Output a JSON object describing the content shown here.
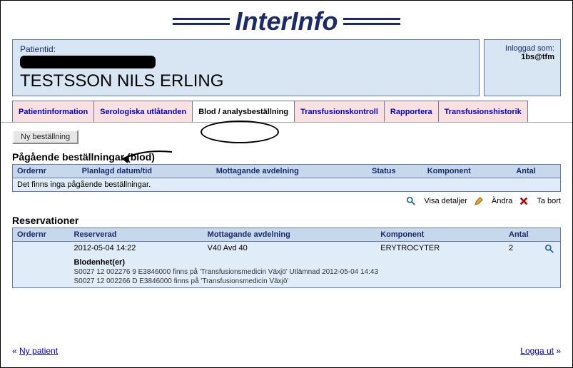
{
  "app_name": "InterInfo",
  "login": {
    "label": "Inloggad som:",
    "user": "1bs@tfm"
  },
  "patient": {
    "label": "Patientid:",
    "name": "TESTSSON NILS ERLING"
  },
  "tabs": [
    {
      "label": "Patientinformation"
    },
    {
      "label": "Serologiska utlåtanden"
    },
    {
      "label": "Blod / analysbeställning"
    },
    {
      "label": "Transfusionskontroll"
    },
    {
      "label": "Rapportera"
    },
    {
      "label": "Transfusionshistorik"
    }
  ],
  "buttons": {
    "new_order": "Ny beställning"
  },
  "sections": {
    "orders_title": "Pågående beställningar (blod)",
    "reservations_title": "Reservationer"
  },
  "orders": {
    "cols": {
      "ordernr": "Ordernr",
      "planned": "Planlagd datum/tid",
      "dept": "Mottagande avdelning",
      "status": "Status",
      "component": "Komponent",
      "qty": "Antal"
    },
    "empty": "Det finns inga pågående beställningar."
  },
  "order_actions": {
    "details": "Visa detaljer",
    "edit": "Ändra",
    "delete": "Ta bort"
  },
  "reservations": {
    "cols": {
      "ordernr": "Ordernr",
      "reserved": "Reserverad",
      "dept": "Mottagande avdelning",
      "component": "Komponent",
      "qty": "Antal"
    },
    "rows": [
      {
        "ordernr": "",
        "reserved": "2012-05-04 14:22",
        "dept": "V40 Avd 40",
        "component": "ERYTROCYTER",
        "qty": "2",
        "units_header": "Blodenhet(er)",
        "units": [
          "S0027 12 002276 9 E3846000 finns på 'Transfusionsmedicin Växjö' Utlämnad 2012-05-04 14:43",
          "S0027 12 002266 D E3846000 finns på 'Transfusionsmedicin Växjö'"
        ]
      }
    ]
  },
  "footer": {
    "new_patient": "Ny patient",
    "logout": "Logga ut"
  }
}
